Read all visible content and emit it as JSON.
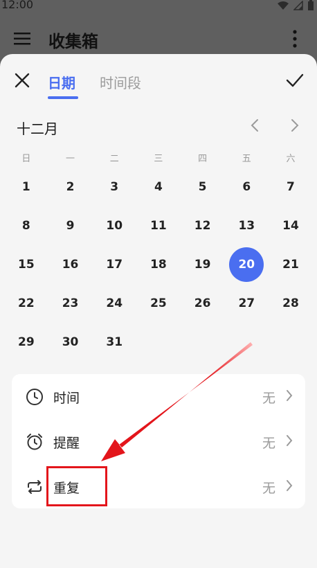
{
  "status": {
    "time": "12:00"
  },
  "app": {
    "title": "收集箱"
  },
  "sheet": {
    "tabs": [
      {
        "label": "日期"
      },
      {
        "label": "时间段"
      }
    ],
    "month": "十二月",
    "weekdays": [
      "日",
      "一",
      "二",
      "三",
      "四",
      "五",
      "六"
    ],
    "days": [
      "1",
      "2",
      "3",
      "4",
      "5",
      "6",
      "7",
      "8",
      "9",
      "10",
      "11",
      "12",
      "13",
      "14",
      "15",
      "16",
      "17",
      "18",
      "19",
      "20",
      "21",
      "22",
      "23",
      "24",
      "25",
      "26",
      "27",
      "28",
      "29",
      "30",
      "31"
    ],
    "selected_day": "20",
    "options": [
      {
        "label": "时间",
        "value": "无",
        "icon": "clock-icon"
      },
      {
        "label": "提醒",
        "value": "无",
        "icon": "alarm-icon"
      },
      {
        "label": "重复",
        "value": "无",
        "icon": "repeat-icon"
      }
    ]
  },
  "colors": {
    "accent": "#4a6ef0",
    "annotation": "#e3151b"
  }
}
